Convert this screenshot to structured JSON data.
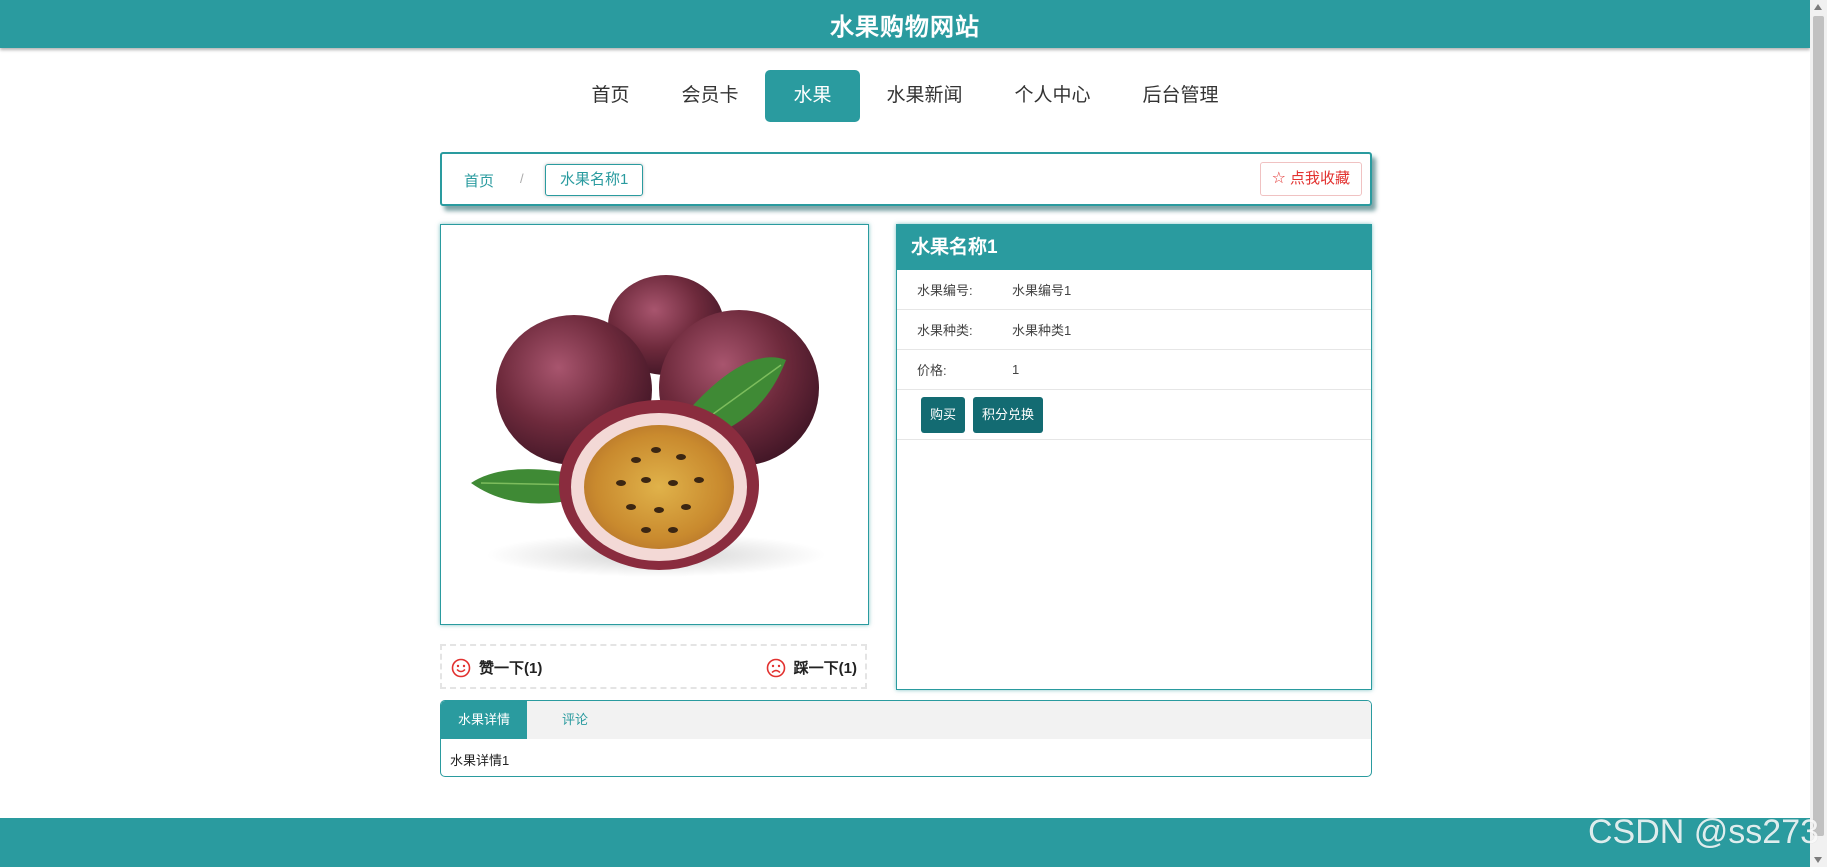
{
  "header": {
    "title": "水果购物网站"
  },
  "nav": {
    "items": [
      {
        "label": "首页"
      },
      {
        "label": "会员卡"
      },
      {
        "label": "水果",
        "active": true
      },
      {
        "label": "水果新闻"
      },
      {
        "label": "个人中心"
      },
      {
        "label": "后台管理"
      }
    ]
  },
  "breadcrumb": {
    "home": "首页",
    "separator": "/",
    "current": "水果名称1",
    "favorite_label": "点我收藏"
  },
  "product": {
    "image_alt": "passion fruit",
    "name": "水果名称1",
    "fields": [
      {
        "label": "水果编号:",
        "value": "水果编号1"
      },
      {
        "label": "水果种类:",
        "value": "水果种类1"
      },
      {
        "label": "价格:",
        "value": "1"
      }
    ],
    "buy_label": "购买",
    "points_label": "积分兑换"
  },
  "votes": {
    "like_label": "赞一下(1)",
    "dislike_label": "踩一下(1)"
  },
  "tabs": {
    "items": [
      {
        "label": "水果详情",
        "active": true
      },
      {
        "label": "评论"
      }
    ],
    "content": "水果详情1"
  },
  "watermark": "CSDN @ss273",
  "colors": {
    "primary": "#2a9b9f",
    "dark_button": "#136b72",
    "favorite_red": "#e2312f"
  }
}
